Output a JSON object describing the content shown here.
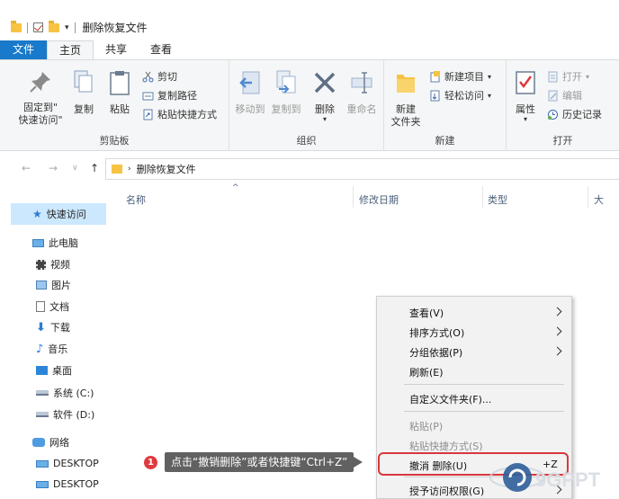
{
  "window": {
    "title": "删除恢复文件"
  },
  "ribbon_tabs": [
    {
      "label": "文件"
    },
    {
      "label": "主页"
    },
    {
      "label": "共享"
    },
    {
      "label": "查看"
    }
  ],
  "ribbon": {
    "clipboard": {
      "label": "剪贴板",
      "pin_line1": "固定到\"",
      "pin_line2": "快速访问\"",
      "copy": "复制",
      "paste": "粘贴",
      "cut": "剪切",
      "copy_path": "复制路径",
      "paste_shortcut": "粘贴快捷方式"
    },
    "organize": {
      "label": "组织",
      "move_to": "移动到",
      "copy_to": "复制到",
      "delete": "删除",
      "rename": "重命名"
    },
    "new": {
      "label": "新建",
      "new_folder_line1": "新建",
      "new_folder_line2": "文件夹",
      "new_item": "新建项目",
      "easy_access": "轻松访问"
    },
    "open": {
      "label": "打开",
      "properties": "属性",
      "open": "打开",
      "edit": "编辑",
      "history": "历史记录"
    }
  },
  "address": {
    "path": "删除恢复文件"
  },
  "columns": [
    {
      "label": "名称"
    },
    {
      "label": "修改日期"
    },
    {
      "label": "类型"
    },
    {
      "label": "大"
    }
  ],
  "nav": {
    "quick_access": "快速访问",
    "this_pc": "此电脑",
    "items": [
      {
        "label": "视频"
      },
      {
        "label": "图片"
      },
      {
        "label": "文档"
      },
      {
        "label": "下载"
      },
      {
        "label": "音乐"
      },
      {
        "label": "桌面"
      },
      {
        "label": "系统 (C:)"
      },
      {
        "label": "软件 (D:)"
      }
    ],
    "network": "网络",
    "net_items": [
      {
        "label": "DESKTOP"
      },
      {
        "label": "DESKTOP"
      }
    ]
  },
  "context_menu": {
    "view": "查看(V)",
    "sort": "排序方式(O)",
    "group": "分组依据(P)",
    "refresh": "刷新(E)",
    "customize": "自定义文件夹(F)...",
    "paste": "粘贴(P)",
    "paste_shortcut": "粘贴快捷方式(S)",
    "undo_delete": "撤消 删除(U)",
    "undo_shortcut": "+Z",
    "grant_access": "授予访问权限(G)"
  },
  "annotation": {
    "step": "1",
    "text": "点击“撤销删除”或者快捷键“Ctrl+Z”"
  },
  "watermark": {
    "text": "9GPPT"
  },
  "colors": {
    "file_tab": "#1979ca",
    "selection": "#cce8ff",
    "highlight": "#d9383d",
    "folder": "#f6c343"
  }
}
